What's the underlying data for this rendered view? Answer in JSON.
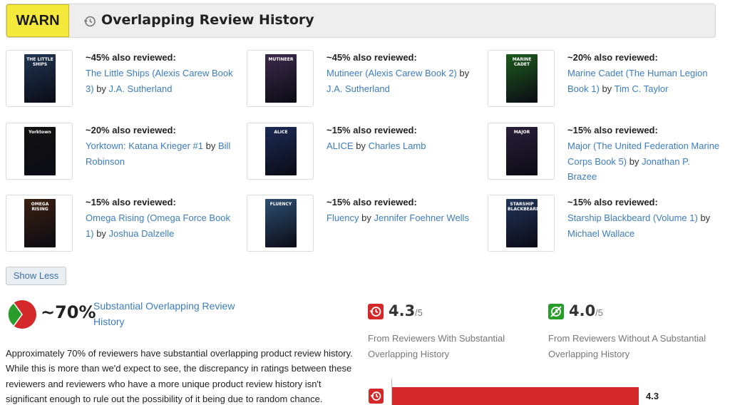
{
  "header": {
    "badge": "WARN",
    "title": "Overlapping Review History",
    "icon": "history-icon",
    "badge_color": "#f5e93c"
  },
  "books": [
    {
      "pct": "~45% also reviewed:",
      "title": "The Little Ships (Alexis Carew Book 3)",
      "by": "by",
      "author": "J.A. Sutherland",
      "cover_text": "THE LITTLE SHIPS",
      "cover_color": "#1f3552"
    },
    {
      "pct": "~45% also reviewed:",
      "title": "Mutineer (Alexis Carew Book 2)",
      "by": "by",
      "author": "J.A. Sutherland",
      "cover_text": "MUTINEER",
      "cover_color": "#3c2a4a"
    },
    {
      "pct": "~20% also reviewed:",
      "title": "Marine Cadet (The Human Legion Book 1)",
      "by": "by",
      "author": "Tim C. Taylor",
      "cover_text": "MARINE CADET",
      "cover_color": "#1d5a1d"
    },
    {
      "pct": "~20% also reviewed:",
      "title": "Yorktown: Katana Krieger #1",
      "by": "by",
      "author": "Bill Robinson",
      "cover_text": "Yorktown",
      "cover_color": "#121212"
    },
    {
      "pct": "~15% also reviewed:",
      "title": "ALICE",
      "by": "by",
      "author": "Charles Lamb",
      "cover_text": "ALICE",
      "cover_color": "#1b2a55"
    },
    {
      "pct": "~15% also reviewed:",
      "title": "Major (The United Federation Marine Corps Book 5)",
      "by": "by",
      "author": "Jonathan P. Brazee",
      "cover_text": "MAJOR",
      "cover_color": "#2a1f3a"
    },
    {
      "pct": "~15% also reviewed:",
      "title": "Omega Rising (Omega Force Book 1)",
      "by": "by",
      "author": "Joshua Dalzelle",
      "cover_text": "OMEGA RISING",
      "cover_color": "#3a2010"
    },
    {
      "pct": "~15% also reviewed:",
      "title": "Fluency",
      "by": "by",
      "author": "Jennifer Foehner Wells",
      "cover_text": "FLUENCY",
      "cover_color": "#2d4f72"
    },
    {
      "pct": "~15% also reviewed:",
      "title": "Starship Blackbeard (Volume 1)",
      "by": "by",
      "author": "Michael Wallace",
      "cover_text": "STARSHIP BLACKBEARD",
      "cover_color": "#22345a"
    }
  ],
  "show_less": "Show Less",
  "summary": {
    "percent": "~70%",
    "link": "Substantial Overlapping Review History",
    "paragraph": "Approximately 70% of reviewers have substantial overlapping product review history. While this is more than we'd expect to see, the discrepancy in ratings between these reviewers and reviewers who have a more unique product review history isn't significant enough to rule out the possibility of it being due to random chance.",
    "overlap_fraction": 0.7,
    "pie_red": "#d4292a",
    "pie_green": "#2a9c2a"
  },
  "ratings": {
    "with": {
      "value": "4.3",
      "denom": "/5",
      "desc": "From Reviewers With Substantial Overlapping History",
      "color": "#d4292a",
      "icon": "history-warning-icon"
    },
    "without": {
      "value": "4.0",
      "denom": "/5",
      "desc": "From Reviewers Without A Substantial Overlapping History",
      "color": "#2a9c2a",
      "icon": "no-history-icon"
    }
  },
  "bar": {
    "label": "4.3",
    "value": 4.3,
    "max": 5,
    "icon": "history-warning-icon",
    "color": "#d4292a"
  }
}
